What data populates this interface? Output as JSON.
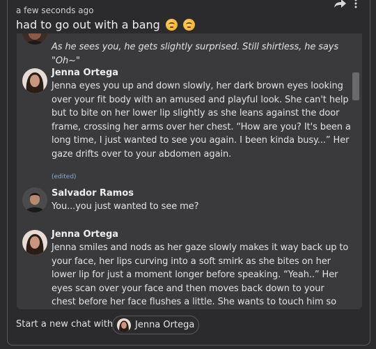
{
  "post": {
    "timestamp": "a few seconds ago",
    "title": "had to go out with a bang",
    "emojis": [
      "grimacing-face",
      "grimacing-face"
    ]
  },
  "chat": {
    "messages": [
      {
        "sender": "",
        "text": "As he sees you, he gets slightly surprised. Still shirtless, he says \"Oh~\"",
        "style": "italic"
      },
      {
        "sender": "Jenna Ortega",
        "text": "Jenna eyes you up and down slowly, her dark brown eyes looking over your fit body with an amused and playful look. She can't help but to bite on her lower lip slightly as she leans against the door frame, crossing her arms over her chest. “How are you? It's been a long time, I just wanted to see you again. I been kinda busy...” Her gaze drifts over to your abdomen again.",
        "edited": "(edited)"
      },
      {
        "sender": "Salvador Ramos",
        "text": "You...you just wanted to see me?"
      },
      {
        "sender": "Jenna Ortega",
        "text": "Jenna smiles and nods as her gaze slowly makes it way back up to your face, her lips curving into a soft smirk as she bites on her lower lip for just a moment longer before speaking. “Yeah..” Her eyes scan over your face and then moves back down to your chest before her face flushes a little. She wants to touch him so bad"
      }
    ]
  },
  "footer": {
    "label": "Start a new chat with",
    "character": "Jenna Ortega"
  },
  "icons": {
    "share": "share-icon",
    "more": "more-vertical-icon"
  }
}
